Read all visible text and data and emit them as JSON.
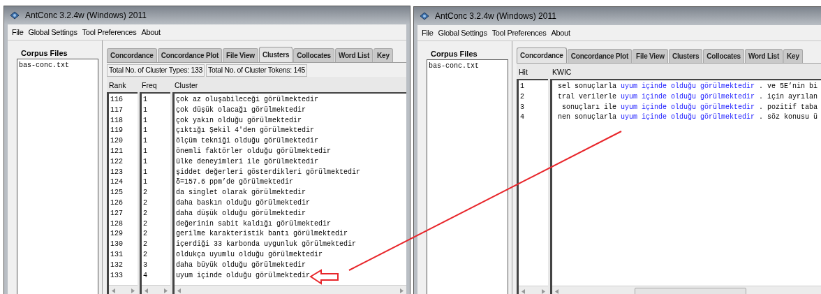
{
  "windows": [
    {
      "kind": "clusters",
      "title": "AntConc 3.2.4w (Windows) 2011",
      "menu": [
        "File",
        "Global Settings",
        "Tool Preferences",
        "About"
      ],
      "corpus_files": {
        "label": "Corpus Files",
        "files": [
          "bas-conc.txt"
        ]
      },
      "tabs": [
        {
          "label": "Concordance",
          "selected": false
        },
        {
          "label": "Concordance Plot",
          "selected": false
        },
        {
          "label": "File View",
          "selected": false
        },
        {
          "label": "Clusters",
          "selected": true
        },
        {
          "label": "Collocates",
          "selected": false
        },
        {
          "label": "Word List",
          "selected": false
        },
        {
          "label": "Key",
          "selected": false
        }
      ],
      "stats": [
        "Total No. of Cluster Types: 133",
        "Total No. of Cluster Tokens: 145"
      ],
      "columns": [
        "Rank",
        "Freq",
        "Cluster"
      ],
      "rows": [
        [
          "116",
          "1",
          "çok az oluşabileceği görülmektedir"
        ],
        [
          "117",
          "1",
          "çok düşük olacağı görülmektedir"
        ],
        [
          "118",
          "1",
          "çok yakın olduğu görülmektedir"
        ],
        [
          "119",
          "1",
          "çıktığı Şekil 4'den görülmektedir"
        ],
        [
          "120",
          "1",
          "ölçüm tekniği olduğu görülmektedir"
        ],
        [
          "121",
          "1",
          "önemli faktörler olduğu görülmektedir"
        ],
        [
          "122",
          "1",
          "ülke deneyimleri ile görülmektedir"
        ],
        [
          "123",
          "1",
          "şiddet değerleri gösterdikleri görülmektedir"
        ],
        [
          "124",
          "1",
          "δ=157.6 ppm’de görülmektedir"
        ],
        [
          "125",
          "2",
          "da singlet olarak görülmektedir"
        ],
        [
          "126",
          "2",
          "daha baskın olduğu görülmektedir"
        ],
        [
          "127",
          "2",
          "daha düşük olduğu görülmektedir"
        ],
        [
          "128",
          "2",
          "değerinin sabit kaldığı görülmektedir"
        ],
        [
          "129",
          "2",
          "gerilme karakteristik bantı görülmektedir"
        ],
        [
          "130",
          "2",
          "içerdiği 33 karbonda uygunluk görülmektedir"
        ],
        [
          "131",
          "2",
          "oldukça uyumlu olduğu görülmektedir"
        ],
        [
          "132",
          "3",
          "daha büyük olduğu görülmektedir"
        ],
        [
          "133",
          "4",
          "uyum içinde olduğu görülmektedir"
        ]
      ]
    },
    {
      "kind": "concordance",
      "title": "AntConc 3.2.4w (Windows) 2011",
      "menu": [
        "File",
        "Global Settings",
        "Tool Preferences",
        "About"
      ],
      "corpus_files": {
        "label": "Corpus Files",
        "files": [
          "bas-conc.txt"
        ]
      },
      "tabs": [
        {
          "label": "Concordance",
          "selected": true
        },
        {
          "label": "Concordance Plot",
          "selected": false
        },
        {
          "label": "File View",
          "selected": false
        },
        {
          "label": "Clusters",
          "selected": false
        },
        {
          "label": "Collocates",
          "selected": false
        },
        {
          "label": "Word List",
          "selected": false
        },
        {
          "label": "Key",
          "selected": false
        }
      ],
      "columns": [
        "Hit",
        "KWIC"
      ],
      "rows": [
        {
          "hit": "1",
          "left": "sel sonuçlarla",
          "keyword": "uyum içinde olduğu görülmektedir",
          "right": ". ve 5E’nin bi"
        },
        {
          "hit": "2",
          "left": "tral verilerle",
          "keyword": "uyum içinde olduğu görülmektedir",
          "right": ". için ayrılan"
        },
        {
          "hit": "3",
          "left": "sonuçları ile",
          "keyword": "uyum içinde olduğu görülmektedir",
          "right": ". pozitif taba"
        },
        {
          "hit": "4",
          "left": "nen sonuçlarla",
          "keyword": "uyum içinde olduğu görülmektedir",
          "right": ". söz konusu ü"
        }
      ]
    }
  ]
}
